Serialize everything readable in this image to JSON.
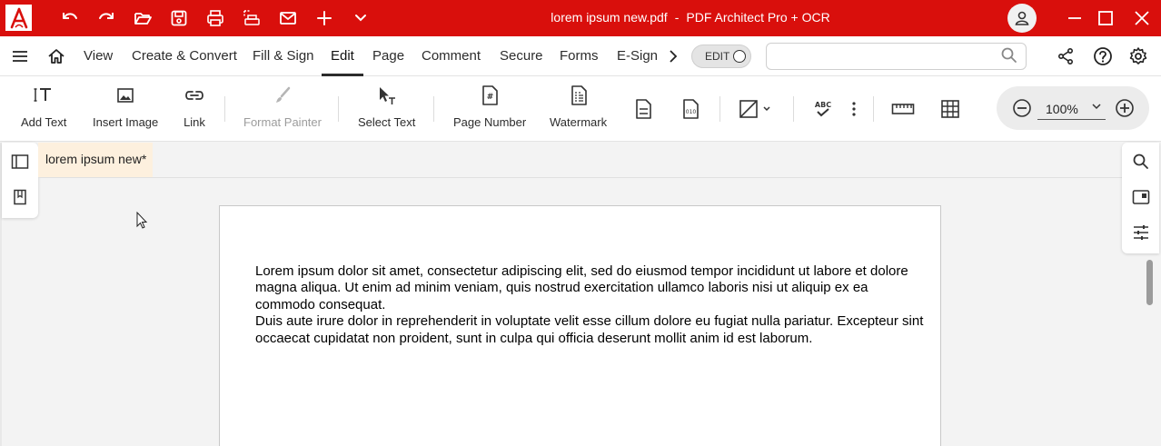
{
  "titlebar": {
    "file_name": "lorem ipsum new.pdf",
    "separator": "-",
    "app_name": "PDF Architect Pro + OCR",
    "background": "#d90f0c"
  },
  "menubar": {
    "items": [
      "View",
      "Create & Convert",
      "Fill & Sign",
      "Edit",
      "Page",
      "Comment",
      "Secure",
      "Forms",
      "E-Sign"
    ],
    "active": "Edit",
    "edit_toggle_label": "EDIT",
    "search": {
      "value": "",
      "placeholder": ""
    }
  },
  "ribbon": {
    "add_text": "Add Text",
    "insert_image": "Insert Image",
    "link": "Link",
    "format_painter": "Format Painter",
    "select_text": "Select Text",
    "page_number": "Page Number",
    "watermark": "Watermark",
    "zoom_value": "100%"
  },
  "document": {
    "tab_label": "lorem ipsum new*",
    "paragraphs": [
      "Lorem ipsum dolor sit amet, consectetur adipiscing elit, sed do eiusmod tempor incididunt ut labore et dolore magna aliqua. Ut enim ad minim veniam, quis nostrud exercitation ullamco laboris nisi ut aliquip ex ea commodo consequat.",
      "Duis aute irure dolor in reprehenderit in voluptate velit esse cillum dolore eu fugiat nulla pariatur. Excepteur sint occaecat cupidatat non proident, sunt in culpa qui officia deserunt mollit anim id est laborum."
    ]
  },
  "icons": {
    "logo": "pdf-architect-logo-icon",
    "qat": [
      "undo-icon",
      "redo-icon",
      "open-folder-icon",
      "save-icon",
      "print-icon",
      "scan-icon",
      "email-icon",
      "add-icon",
      "chevron-down-icon"
    ]
  }
}
